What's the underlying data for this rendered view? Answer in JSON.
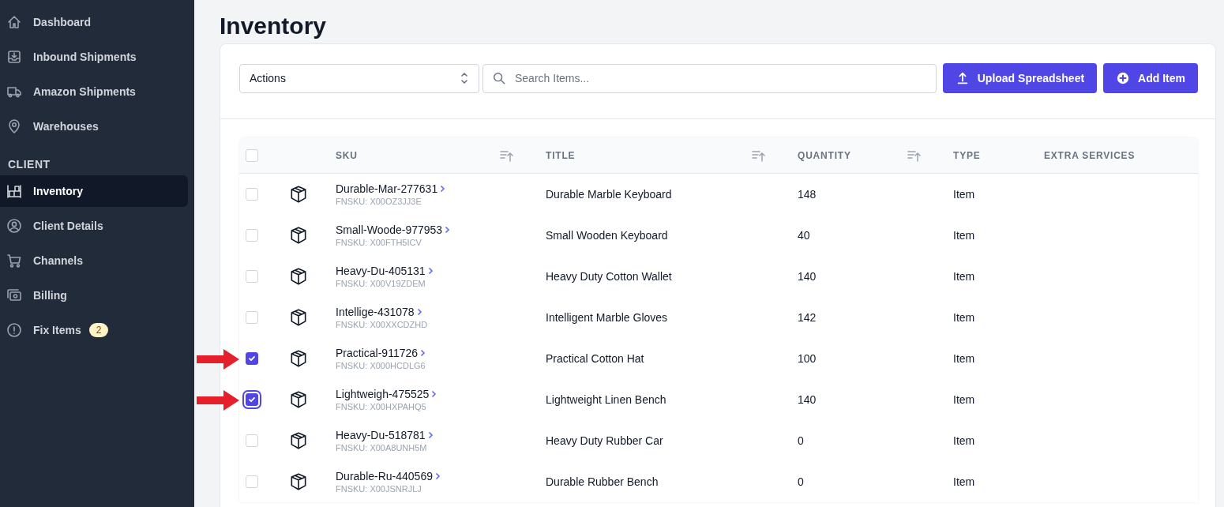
{
  "sidebar": {
    "items": [
      {
        "kind": "link",
        "label": "Dashboard",
        "selected": false
      },
      {
        "kind": "link",
        "label": "Inbound Shipments",
        "selected": false
      },
      {
        "kind": "link",
        "label": "Amazon Shipments",
        "selected": false
      },
      {
        "kind": "link",
        "label": "Warehouses",
        "selected": false
      },
      {
        "kind": "section",
        "label": "CLIENT"
      },
      {
        "kind": "link",
        "label": "Inventory",
        "selected": true
      },
      {
        "kind": "link",
        "label": "Client Details",
        "selected": false
      },
      {
        "kind": "link",
        "label": "Channels",
        "selected": false
      },
      {
        "kind": "link",
        "label": "Billing",
        "selected": false
      },
      {
        "kind": "link",
        "label": "Fix Items",
        "selected": false,
        "badge": "2"
      }
    ]
  },
  "page": {
    "title": "Inventory"
  },
  "toolbar": {
    "actions": {
      "value": "Actions"
    },
    "search": {
      "placeholder": "Search Items..."
    },
    "buttons": [
      {
        "label": "Upload Spreadsheet"
      },
      {
        "label": "Add Item"
      }
    ]
  },
  "table": {
    "select_all": {
      "checked": false
    },
    "columns": [
      {
        "label": "SKU",
        "sortable": true
      },
      {
        "label": "TITLE",
        "sortable": true
      },
      {
        "label": "QUANTITY",
        "sortable": true
      },
      {
        "label": "TYPE",
        "sortable": false
      },
      {
        "label": "EXTRA SERVICES",
        "sortable": false
      }
    ],
    "rows": [
      {
        "checked": false,
        "focused": false,
        "highlighted": false,
        "sku": "Durable-Mar-277631",
        "fnsku": "FNSKU: X00OZ3JJ3E",
        "title": "Durable Marble Keyboard",
        "quantity": "148",
        "type": "Item"
      },
      {
        "checked": false,
        "focused": false,
        "highlighted": false,
        "sku": "Small-Woode-977953",
        "fnsku": "FNSKU: X00FTH5ICV",
        "title": "Small Wooden Keyboard",
        "quantity": "40",
        "type": "Item"
      },
      {
        "checked": false,
        "focused": false,
        "highlighted": false,
        "sku": "Heavy-Du-405131",
        "fnsku": "FNSKU: X00V19ZDEM",
        "title": "Heavy Duty Cotton Wallet",
        "quantity": "140",
        "type": "Item"
      },
      {
        "checked": false,
        "focused": false,
        "highlighted": false,
        "sku": "Intellige-431078",
        "fnsku": "FNSKU: X00XXCDZHD",
        "title": "Intelligent Marble Gloves",
        "quantity": "142",
        "type": "Item"
      },
      {
        "checked": true,
        "focused": false,
        "highlighted": true,
        "sku": "Practical-911726",
        "fnsku": "FNSKU: X000HCDLG6",
        "title": "Practical Cotton Hat",
        "quantity": "100",
        "type": "Item"
      },
      {
        "checked": true,
        "focused": true,
        "highlighted": true,
        "sku": "Lightweigh-475525",
        "fnsku": "FNSKU: X00HXPAHQ5",
        "title": "Lightweight Linen Bench",
        "quantity": "140",
        "type": "Item"
      },
      {
        "checked": false,
        "focused": false,
        "highlighted": false,
        "sku": "Heavy-Du-518781",
        "fnsku": "FNSKU: X00A8UNH5M",
        "title": "Heavy Duty Rubber Car",
        "quantity": "0",
        "type": "Item"
      },
      {
        "checked": false,
        "focused": false,
        "highlighted": false,
        "sku": "Durable-Ru-440569",
        "fnsku": "FNSKU: X00JSNRJLJ",
        "title": "Durable Rubber Bench",
        "quantity": "0",
        "type": "Item"
      }
    ]
  }
}
